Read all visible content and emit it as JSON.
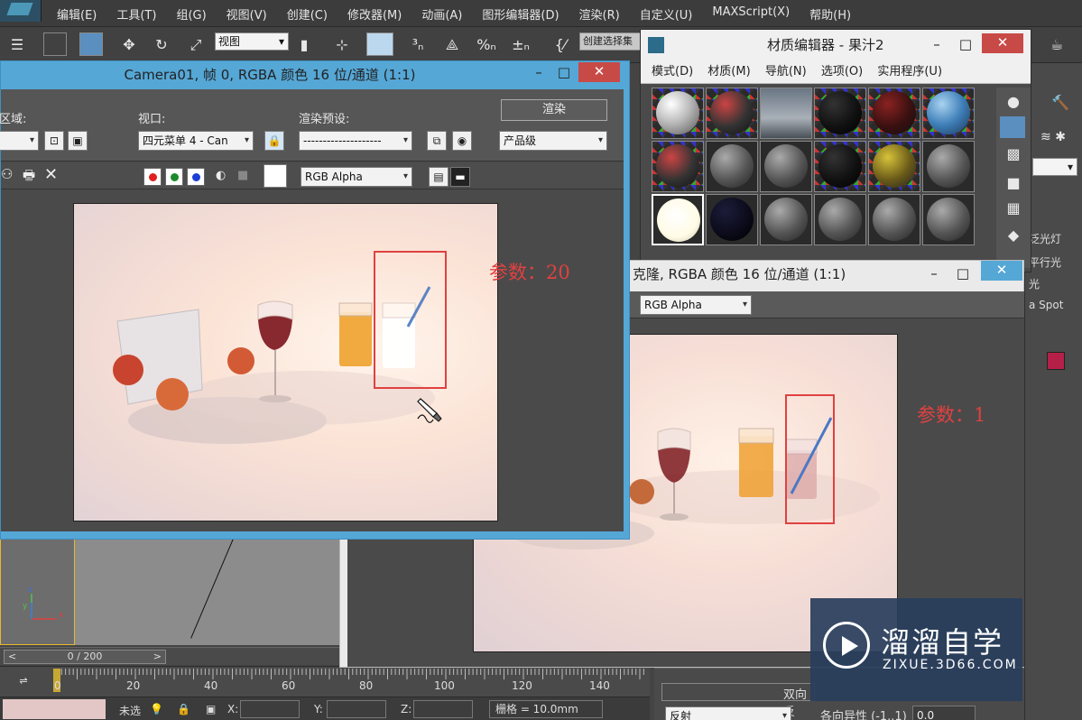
{
  "app": {
    "menus": [
      "编辑(E)",
      "工具(T)",
      "组(G)",
      "视图(V)",
      "创建(C)",
      "修改器(M)",
      "动画(A)",
      "图形编辑器(D)",
      "渲染(R)",
      "自定义(U)",
      "MAXScript(X)",
      "帮助(H)"
    ],
    "toolbar": {
      "view_select": "视图",
      "named_selection": "创建选择集"
    },
    "command_panel": {
      "items": [
        "泛光灯",
        "平行光",
        "光",
        "a Spot"
      ],
      "select_arrow": "▾"
    }
  },
  "render_window_1": {
    "title": "Camera01, 帧 0, RGBA 颜色 16 位/通道 (1:1)",
    "area_label": "区域:",
    "viewport_label": "视口:",
    "viewport_value": "四元菜单 4 - Can",
    "preset_label": "渲染预设:",
    "preset_value": "--------------------",
    "render_button": "渲染",
    "render_level": "产品级",
    "channel_value": "RGB Alpha",
    "annotation": "参数：20"
  },
  "material_editor": {
    "title": "材质编辑器 - 果汁2",
    "menus": [
      "模式(D)",
      "材质(M)",
      "导航(N)",
      "选项(O)",
      "实用程序(U)"
    ]
  },
  "render_window_2": {
    "title": "克隆, RGBA 颜色 16 位/通道 (1:1)",
    "channel_value": "RGB Alpha",
    "annotation": "参数：1"
  },
  "timeline": {
    "frame_display": "0 / 200",
    "left_arrow": "<",
    "right_arrow": ">",
    "ticks": [
      "0",
      "20",
      "40",
      "60",
      "80",
      "100",
      "120",
      "140"
    ]
  },
  "status": {
    "selection_text": "未选",
    "x_label": "X:",
    "y_label": "Y:",
    "z_label": "Z:",
    "grid": "栅格 = 10.0mm"
  },
  "param_panel": {
    "double_label": "双向反",
    "reflect_label": "反射",
    "anisotropy_label": "各向异性 (-1..1)",
    "anisotropy_value": "0.0"
  },
  "watermark": {
    "title": "溜溜自学",
    "url": "ZIXUE.3D66.COM"
  },
  "colors": {
    "annotation": "#e04141",
    "title_bar_active": "#55a7d6",
    "close_button": "#c84a47"
  }
}
